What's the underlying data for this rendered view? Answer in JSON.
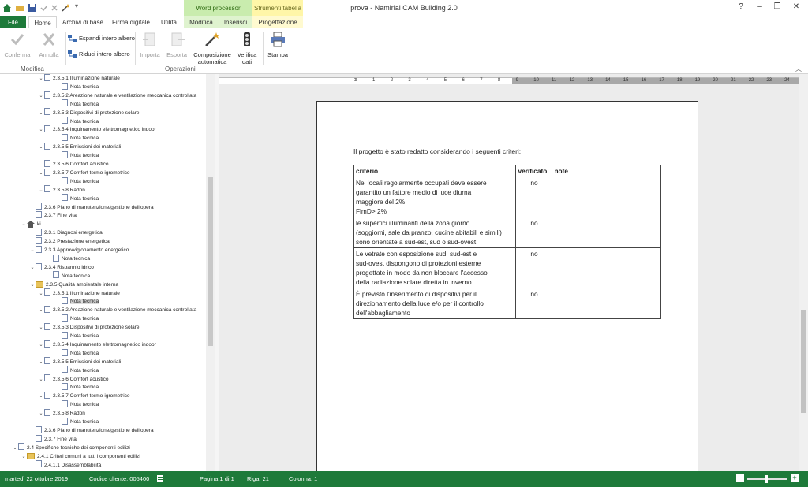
{
  "window": {
    "title": "prova - Namirial CAM Building 2.0",
    "help": "?",
    "minimize": "–",
    "restore": "❐",
    "close": "✕"
  },
  "context_groups": {
    "word": "Word processor",
    "table": "Strumenti tabella"
  },
  "tabs": [
    "File",
    "Home",
    "Archivi di base",
    "Firma digitale",
    "Utilità",
    "Modifica",
    "Inserisci",
    "Progettazione"
  ],
  "ribbon": {
    "confirm": "Conferma",
    "cancel": "Annulla",
    "expand": "Espandi intero albero",
    "collapse": "Riduci intero albero",
    "import": "Importa",
    "export": "Esporta",
    "auto_compose_1": "Composizione",
    "auto_compose_2": "automatica",
    "verify_1": "Verifica",
    "verify_2": "dati",
    "print": "Stampa",
    "group_modifica": "Modifica",
    "group_operazioni": "Operazioni"
  },
  "tree": [
    {
      "label": "2.3.5.1 Illuminazione naturale",
      "indent": 4,
      "icon": "doc",
      "chev": "v"
    },
    {
      "label": "Nota tecnica",
      "indent": 6,
      "icon": "doc",
      "chev": ""
    },
    {
      "label": "2.3.5.2 Areazione naturale e ventilazione meccanica controllata",
      "indent": 4,
      "icon": "doc",
      "chev": "v"
    },
    {
      "label": "Nota tecnica",
      "indent": 6,
      "icon": "doc",
      "chev": ""
    },
    {
      "label": "2.3.5.3 Dispositivi di protezione solare",
      "indent": 4,
      "icon": "doc",
      "chev": "v"
    },
    {
      "label": "Nota tecnica",
      "indent": 6,
      "icon": "doc",
      "chev": ""
    },
    {
      "label": "2.3.5.4 Inquinamento elettromagnetico indoor",
      "indent": 4,
      "icon": "doc",
      "chev": "v"
    },
    {
      "label": "Nota tecnica",
      "indent": 6,
      "icon": "doc",
      "chev": ""
    },
    {
      "label": "2.3.5.5 Emissioni dei materiali",
      "indent": 4,
      "icon": "doc",
      "chev": "v"
    },
    {
      "label": "Nota tecnica",
      "indent": 6,
      "icon": "doc",
      "chev": ""
    },
    {
      "label": "2.3.5.6 Comfort acustico",
      "indent": 4,
      "icon": "doc",
      "chev": ""
    },
    {
      "label": "2.3.5.7 Comfort termo-igrometrico",
      "indent": 4,
      "icon": "doc",
      "chev": "v"
    },
    {
      "label": "Nota tecnica",
      "indent": 6,
      "icon": "doc",
      "chev": ""
    },
    {
      "label": "2.3.5.8 Radon",
      "indent": 4,
      "icon": "doc",
      "chev": "v"
    },
    {
      "label": "Nota tecnica",
      "indent": 6,
      "icon": "doc",
      "chev": ""
    },
    {
      "label": "2.3.6 Piano di manutenzione/gestione dell'opera",
      "indent": 3,
      "icon": "doc",
      "chev": ""
    },
    {
      "label": "2.3.7 Fine vita",
      "indent": 3,
      "icon": "doc",
      "chev": ""
    },
    {
      "label": "ki",
      "indent": 2,
      "icon": "home",
      "chev": "v"
    },
    {
      "label": "2.3.1 Diagnosi energetica",
      "indent": 3,
      "icon": "doc",
      "chev": ""
    },
    {
      "label": "2.3.2 Prestazione energetica",
      "indent": 3,
      "icon": "doc",
      "chev": ""
    },
    {
      "label": "2.3.3 Approvvigionamento energetico",
      "indent": 3,
      "icon": "doc",
      "chev": "v"
    },
    {
      "label": "Nota tecnica",
      "indent": 5,
      "icon": "doc",
      "chev": ""
    },
    {
      "label": "2.3.4 Risparmio idrico",
      "indent": 3,
      "icon": "doc",
      "chev": "v"
    },
    {
      "label": "Nota tecnica",
      "indent": 5,
      "icon": "doc",
      "chev": ""
    },
    {
      "label": "2.3.5 Qualità ambientale interna",
      "indent": 3,
      "icon": "folder",
      "chev": "v"
    },
    {
      "label": "2.3.5.1 Illuminazione naturale",
      "indent": 4,
      "icon": "doc",
      "chev": "v"
    },
    {
      "label": "Nota tecnica",
      "indent": 6,
      "icon": "doc",
      "chev": "",
      "selected": true
    },
    {
      "label": "2.3.5.2 Areazione naturale e ventilazione meccanica controllata",
      "indent": 4,
      "icon": "doc",
      "chev": "v"
    },
    {
      "label": "Nota tecnica",
      "indent": 6,
      "icon": "doc",
      "chev": ""
    },
    {
      "label": "2.3.5.3 Dispositivi di protezione solare",
      "indent": 4,
      "icon": "doc",
      "chev": "v"
    },
    {
      "label": "Nota tecnica",
      "indent": 6,
      "icon": "doc",
      "chev": ""
    },
    {
      "label": "2.3.5.4 Inquinamento elettromagnetico indoor",
      "indent": 4,
      "icon": "doc",
      "chev": "v"
    },
    {
      "label": "Nota tecnica",
      "indent": 6,
      "icon": "doc",
      "chev": ""
    },
    {
      "label": "2.3.5.5 Emissioni dei materiali",
      "indent": 4,
      "icon": "doc",
      "chev": "v"
    },
    {
      "label": "Nota tecnica",
      "indent": 6,
      "icon": "doc",
      "chev": ""
    },
    {
      "label": "2.3.5.6 Comfort acustico",
      "indent": 4,
      "icon": "doc",
      "chev": "v"
    },
    {
      "label": "Nota tecnica",
      "indent": 6,
      "icon": "doc",
      "chev": ""
    },
    {
      "label": "2.3.5.7 Comfort termo-igrometrico",
      "indent": 4,
      "icon": "doc",
      "chev": "v"
    },
    {
      "label": "Nota tecnica",
      "indent": 6,
      "icon": "doc",
      "chev": ""
    },
    {
      "label": "2.3.5.8 Radon",
      "indent": 4,
      "icon": "doc",
      "chev": "v"
    },
    {
      "label": "Nota tecnica",
      "indent": 6,
      "icon": "doc",
      "chev": ""
    },
    {
      "label": "2.3.6 Piano di manutenzione/gestione dell'opera",
      "indent": 3,
      "icon": "doc",
      "chev": ""
    },
    {
      "label": "2.3.7 Fine vita",
      "indent": 3,
      "icon": "doc",
      "chev": ""
    },
    {
      "label": "2.4 Specifiche tecniche dei componenti edilizi",
      "indent": 1,
      "icon": "doc",
      "chev": "v"
    },
    {
      "label": "2.4.1 Criteri comuni a tutti i componenti edilizi",
      "indent": 2,
      "icon": "folder",
      "chev": "v"
    },
    {
      "label": "2.4.1.1 Disassemblabilità",
      "indent": 3,
      "icon": "doc",
      "chev": ""
    }
  ],
  "ruler": {
    "labels": [
      "1",
      "2",
      "3",
      "4",
      "5",
      "6",
      "7",
      "8",
      "9",
      "10",
      "11",
      "12",
      "13",
      "14",
      "15",
      "16",
      "17",
      "18",
      "19",
      "20",
      "21",
      "22",
      "23",
      "24"
    ]
  },
  "document": {
    "intro": "Il progetto è stato redatto considerando i seguenti criteri:",
    "headers": {
      "criterio": "criterio",
      "verificato": "verificato",
      "note": "note"
    },
    "rows": [
      {
        "lines": [
          "Nei locali regolarmente occupati deve essere",
          "garantito un fattore medio di luce diurna",
          "maggiore del 2%",
          "FlmD> 2%"
        ],
        "verificato": "no",
        "note": ""
      },
      {
        "lines": [
          "le superfici illuminanti della zona giorno",
          "(soggiorni, sale da pranzo, cucine abitabili e simili)",
          "sono orientate a sud-est, sud o sud-ovest"
        ],
        "verificato": "no",
        "note": ""
      },
      {
        "lines": [
          "Le vetrate con esposizione sud, sud-est e",
          "sud-ovest dispongono di protezioni esterne",
          "progettate in modo da non bloccare l'accesso",
          "della radiazione solare diretta in inverno"
        ],
        "verificato": "no",
        "note": ""
      },
      {
        "lines": [
          "È previsto l'inserimento di dispositivi per il",
          "direzionamento della luce e/o per il controllo",
          "dell'abbagliamento"
        ],
        "verificato": "no",
        "note": ""
      }
    ]
  },
  "status": {
    "date": "martedì 22 ottobre 2019",
    "client_code": "Codice cliente: 005400",
    "page": "Pagina 1 di 1",
    "row": "Riga: 21",
    "column": "Colonna: 1",
    "zoom_out": "–",
    "zoom_in": "+"
  },
  "colors": {
    "accent": "#1e7a3a",
    "word_ctx": "#c9ecae",
    "table_ctx": "#fff6a8"
  }
}
